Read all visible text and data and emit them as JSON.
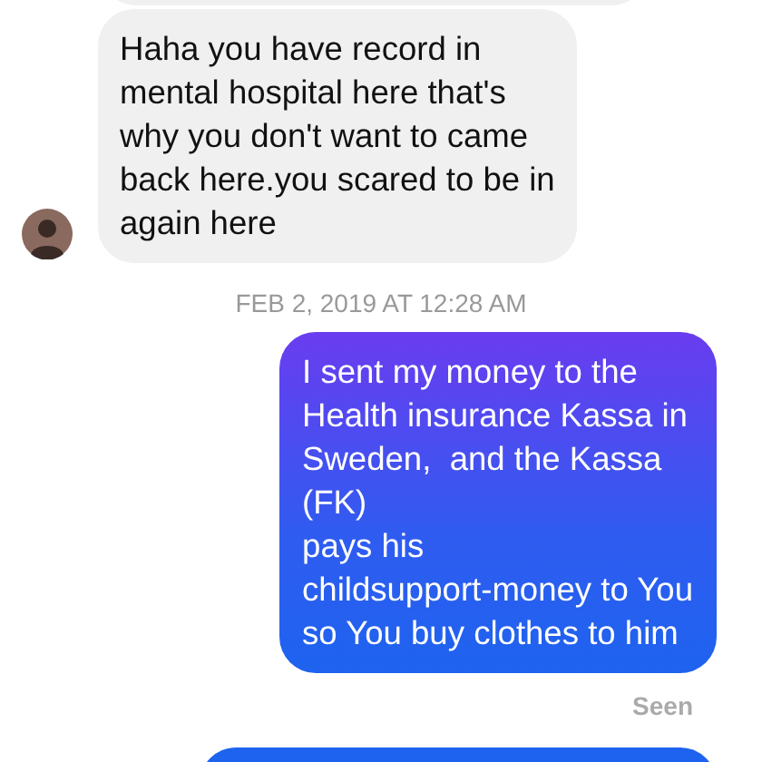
{
  "conversation": [
    {
      "kind": "received_cut"
    },
    {
      "kind": "received",
      "text": "Haha you have record in\nmental hospital here that's\nwhy you don't want to came\nback here.you scared to be in\nagain here"
    },
    {
      "kind": "timestamp",
      "text": "FEB 2, 2019 AT 12:28 AM"
    },
    {
      "kind": "sent",
      "text": "I sent my money to the\nHealth insurance Kassa in\nSweden,  and the Kassa\n(FK)\npays his\nchildsupport-money to You\nso You buy clothes to him"
    },
    {
      "kind": "status",
      "text": "Seen"
    },
    {
      "kind": "sent_cut"
    }
  ]
}
